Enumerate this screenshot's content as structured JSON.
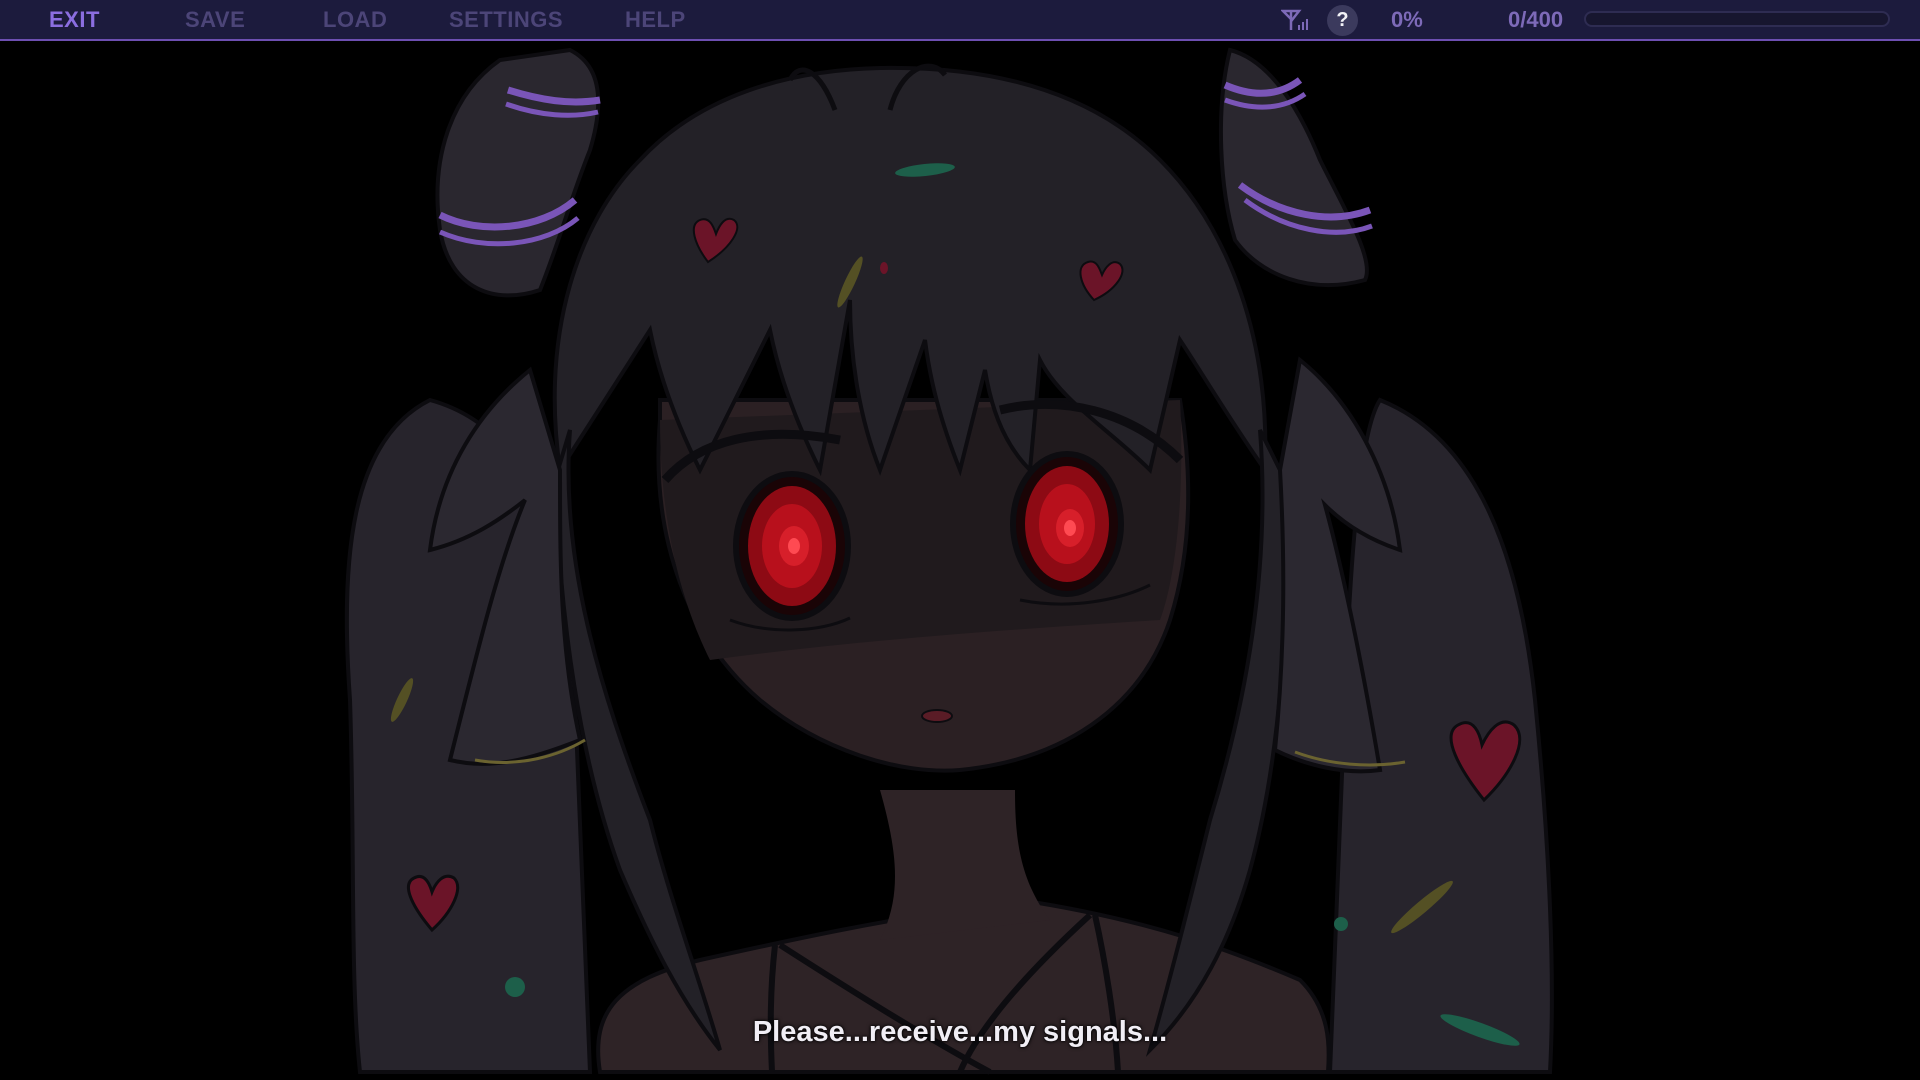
{
  "menu": {
    "exit": "EXIT",
    "save": "SAVE",
    "load": "LOAD",
    "settings": "SETTINGS",
    "help": "HELP"
  },
  "status": {
    "help_glyph": "?",
    "percent": "0%",
    "counter": "0/400",
    "progress_fraction": 0
  },
  "dialogue": {
    "line": "Please...receive...my signals..."
  },
  "colors": {
    "bar_bg": "#1c1b3d",
    "accent": "#8b6ee0",
    "inactive_menu": "#4c4578"
  }
}
